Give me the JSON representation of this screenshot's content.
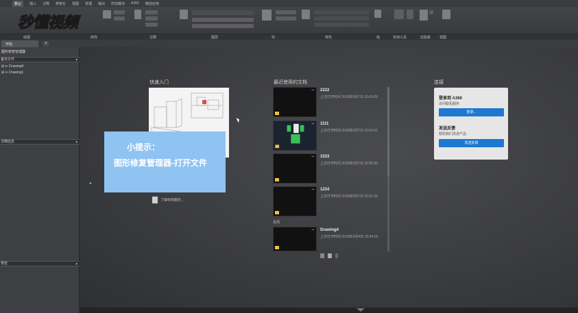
{
  "ribbon": {
    "tabs": [
      "默认",
      "插入",
      "注释",
      "参数化",
      "视图",
      "管理",
      "输出",
      "附加模块",
      "A360",
      "精选应用"
    ],
    "groups": [
      "绘图",
      "修改",
      "注释",
      "图层",
      "块",
      "特性",
      "组",
      "实用工具",
      "剪贴板",
      "视图"
    ]
  },
  "logo_text": "秒懂视频",
  "doc_tabs": {
    "active": "开始",
    "plus": "+"
  },
  "left_panel": {
    "title": "图形修复管理器",
    "backup_header": "备份文件",
    "drawings": [
      "Drawing4",
      "Drawing1"
    ],
    "details_header": "详细信息",
    "preview_header": "预览"
  },
  "quick_start": {
    "title": "快速入门",
    "learn_label": "了解样例图形..."
  },
  "tip": {
    "title": "小提示：",
    "text": "图形修复管理器-打开文件"
  },
  "recent": {
    "title": "最近使用的文档",
    "items": [
      {
        "name": "2222",
        "date": "上次打开时间 2018年9月7日 23:04:25",
        "thumb": "dark"
      },
      {
        "name": "1111",
        "date": "上次打开时间 2018年9月7日 23:04:01",
        "thumb": "green"
      },
      {
        "name": "3333",
        "date": "上次打开时间 2018年9月7日 22:55:39",
        "thumb": "dark"
      },
      {
        "name": "1234",
        "date": "上次打开时间 2018年9月7日 22:51:33",
        "thumb": "dark"
      }
    ],
    "week_group": "本周",
    "week_items": [
      {
        "name": "Drawing4",
        "date": "上次打开时间 2018年9月4日 19:34:19",
        "thumb": "dark"
      }
    ]
  },
  "connect": {
    "title": "连接",
    "login_title": "登录到 A360",
    "login_sub": "访问联机服务",
    "login_button": "登录...",
    "feedback_title": "发送反馈",
    "feedback_sub": "帮助我们改进产品",
    "feedback_button": "发送反馈"
  },
  "colors": {
    "accent": "#1d78d0",
    "tip_bg": "#8fc3f2",
    "bg": "#2f3033"
  }
}
